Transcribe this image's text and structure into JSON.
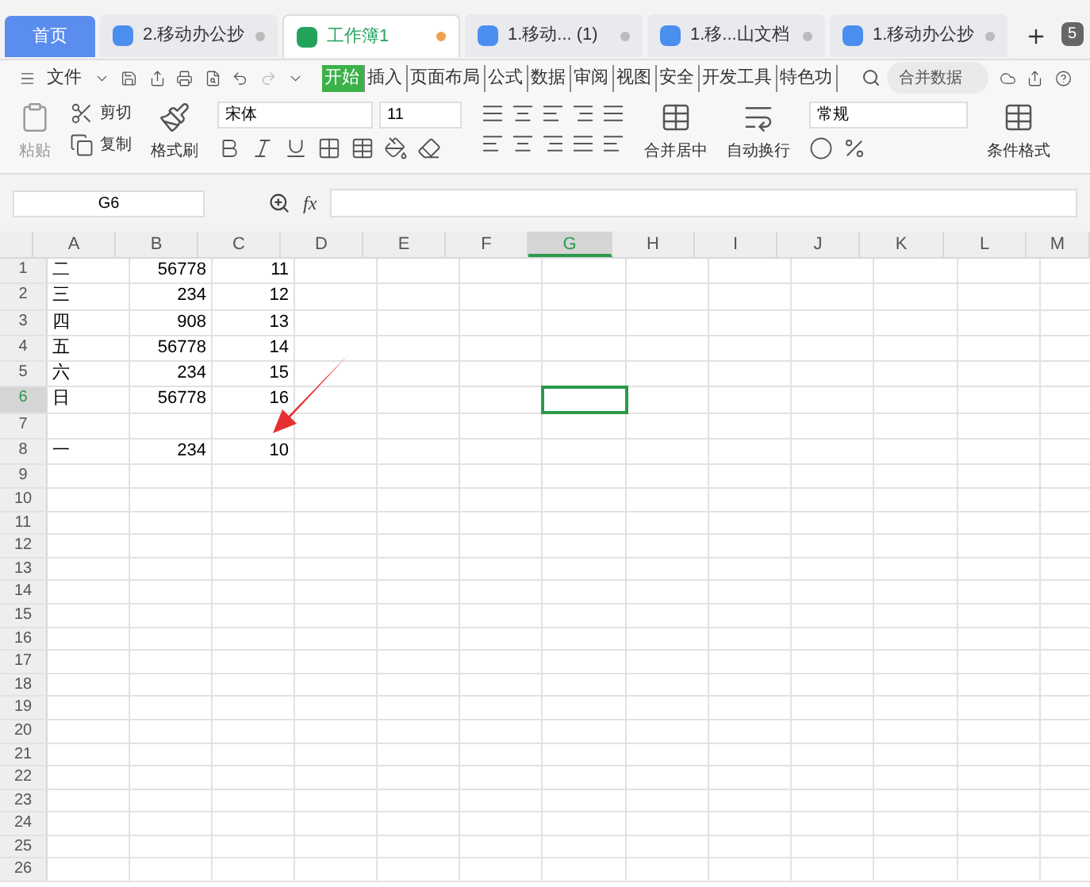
{
  "doc_tabs": [
    {
      "label": "首页",
      "kind": "home",
      "selected": false
    },
    {
      "label": "2.移动办公抄",
      "kind": "word",
      "selected": false
    },
    {
      "label": "工作簿1",
      "kind": "sheet",
      "selected": true
    },
    {
      "label": "1.移动... (1)",
      "kind": "word",
      "selected": false
    },
    {
      "label": "1.移...山文档",
      "kind": "word",
      "selected": false
    },
    {
      "label": "1.移动办公抄",
      "kind": "word",
      "selected": false
    }
  ],
  "tab_count": "5",
  "file_menu": "文件",
  "menu_tabs": [
    {
      "label": "开始",
      "selected": true
    },
    {
      "label": "插入",
      "selected": false
    },
    {
      "label": "页面布局",
      "selected": false
    },
    {
      "label": "公式",
      "selected": false
    },
    {
      "label": "数据",
      "selected": false
    },
    {
      "label": "审阅",
      "selected": false
    },
    {
      "label": "视图",
      "selected": false
    },
    {
      "label": "安全",
      "selected": false
    },
    {
      "label": "开发工具",
      "selected": false
    },
    {
      "label": "特色功",
      "selected": false
    }
  ],
  "search": {
    "placeholder": "合并数据"
  },
  "ribbon": {
    "paste": "粘贴",
    "cut": "剪切",
    "copy": "复制",
    "format_painter": "格式刷",
    "font": "宋体",
    "size": "11",
    "merge": "合并居中",
    "wrap": "自动换行",
    "number_format": "常规",
    "conditional": "条件格式"
  },
  "name_box": "G6",
  "fx": "fx",
  "columns": [
    {
      "label": "A",
      "selected": false
    },
    {
      "label": "B",
      "selected": false
    },
    {
      "label": "C",
      "selected": false
    },
    {
      "label": "D",
      "selected": false
    },
    {
      "label": "E",
      "selected": false
    },
    {
      "label": "F",
      "selected": false
    },
    {
      "label": "G",
      "selected": true
    },
    {
      "label": "H",
      "selected": false
    },
    {
      "label": "I",
      "selected": false
    },
    {
      "label": "J",
      "selected": false
    },
    {
      "label": "K",
      "selected": false
    },
    {
      "label": "L",
      "selected": false
    },
    {
      "label": "M",
      "selected": false
    }
  ],
  "rows": [
    {
      "number": "1",
      "selected": false,
      "cells": [
        "二",
        "56778",
        "11"
      ]
    },
    {
      "number": "2",
      "selected": false,
      "cells": [
        "三",
        "234",
        "12"
      ]
    },
    {
      "number": "3",
      "selected": false,
      "cells": [
        "四",
        "908",
        "13"
      ]
    },
    {
      "number": "4",
      "selected": false,
      "cells": [
        "五",
        "56778",
        "14"
      ]
    },
    {
      "number": "5",
      "selected": false,
      "cells": [
        "六",
        "234",
        "15"
      ]
    },
    {
      "number": "6",
      "selected": true,
      "cells": [
        "日",
        "56778",
        "16"
      ]
    },
    {
      "number": "7",
      "selected": false
    },
    {
      "number": "8",
      "selected": false,
      "cells": [
        "一",
        "234",
        "10"
      ]
    },
    {
      "number": "9",
      "selected": false
    },
    {
      "number": "10",
      "selected": false
    },
    {
      "number": "11",
      "selected": false
    },
    {
      "number": "12",
      "selected": false
    },
    {
      "number": "13",
      "selected": false
    },
    {
      "number": "14",
      "selected": false
    },
    {
      "number": "15",
      "selected": false
    },
    {
      "number": "16",
      "selected": false
    },
    {
      "number": "17",
      "selected": false
    },
    {
      "number": "18",
      "selected": false
    },
    {
      "number": "19",
      "selected": false
    },
    {
      "number": "20",
      "selected": false
    },
    {
      "number": "21",
      "selected": false
    },
    {
      "number": "22",
      "selected": false
    },
    {
      "number": "23",
      "selected": false
    },
    {
      "number": "24",
      "selected": false
    },
    {
      "number": "25",
      "selected": false
    },
    {
      "number": "26",
      "selected": false
    }
  ]
}
